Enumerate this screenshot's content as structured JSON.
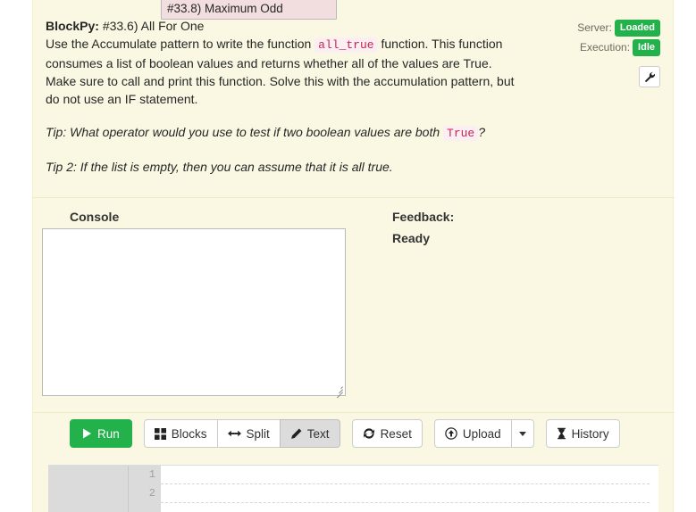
{
  "tooltip": {
    "text": "#33.8) Maximum Odd"
  },
  "instructions": {
    "app_name": "BlockPy:",
    "assignment_title": "#33.6) All For One",
    "body_part1": "Use the Accumulate pattern to write the function",
    "code_all_true": "all_true",
    "body_part2": "function. This function consumes a list of boolean values and returns whether all of the values are True. Make sure to call and print this function. Solve this with the accumulation pattern, but do not use an IF statement.",
    "tip1_part1": "Tip: What operator would you use to test if two boolean values are both",
    "tip1_code": "True",
    "tip1_part2": "?",
    "tip2": "Tip 2: If the list is empty, then you can assume that it is all true."
  },
  "status": {
    "server_label": "Server:",
    "server_value": "Loaded",
    "execution_label": "Execution:",
    "execution_value": "Idle",
    "badge_color": "#23B14C",
    "wrench_icon": "wrench-icon"
  },
  "console": {
    "heading": "Console",
    "value": "",
    "placeholder": ""
  },
  "feedback": {
    "heading": "Feedback:",
    "status": "Ready"
  },
  "toolbar": {
    "run_label": "Run",
    "run_color": "#23B14C",
    "blocks_label": "Blocks",
    "split_label": "Split",
    "text_label": "Text",
    "active_view": "Text",
    "reset_label": "Reset",
    "upload_label": "Upload",
    "history_label": "History",
    "icons": {
      "run": "play-icon",
      "blocks": "grid-squares-icon",
      "split": "left-right-arrow-icon",
      "text": "pencil-icon",
      "reset": "refresh-icon",
      "upload": "circle-up-arrow-icon",
      "dropdown": "chevron-down-icon",
      "history": "hourglass-icon"
    }
  },
  "editor": {
    "line_numbers": [
      "1",
      "2"
    ],
    "lines": [
      "",
      ""
    ]
  }
}
